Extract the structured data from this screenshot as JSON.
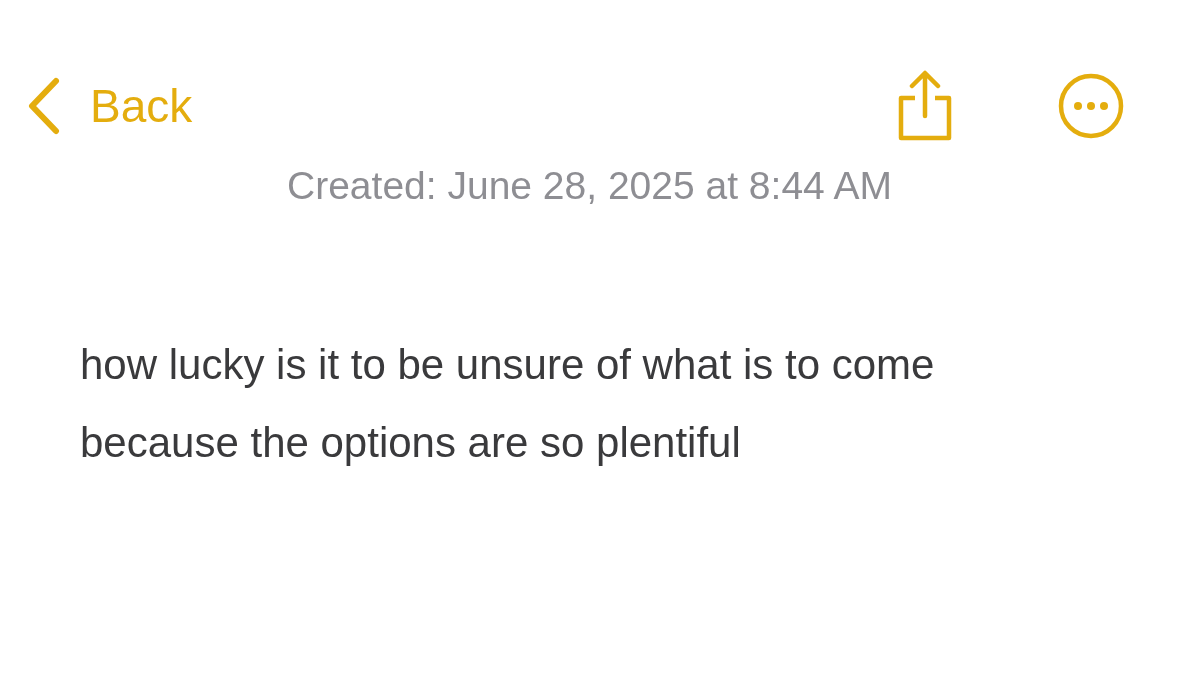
{
  "nav": {
    "back_label": "Back"
  },
  "created": "Created: June 28, 2025 at 8:44 AM",
  "note": {
    "body": "how lucky is it to be unsure of what is to come because the options are so plentiful"
  }
}
